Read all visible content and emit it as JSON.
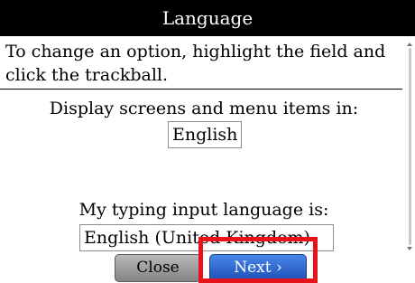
{
  "window": {
    "title": "Language"
  },
  "content": {
    "instructions": "To change an option, highlight the field and click the trackball.",
    "display_label": "Display screens and menu items in:",
    "display_value": "English",
    "typing_label": "My typing input language is:",
    "typing_value": "English (United Kingdom)"
  },
  "buttons": {
    "close_label": "Close",
    "next_label": "Next ›"
  },
  "colors": {
    "titlebar": "#000000",
    "next_button": "#2a62d0",
    "close_button": "#a0a0a0",
    "highlight": "#e8121a"
  }
}
